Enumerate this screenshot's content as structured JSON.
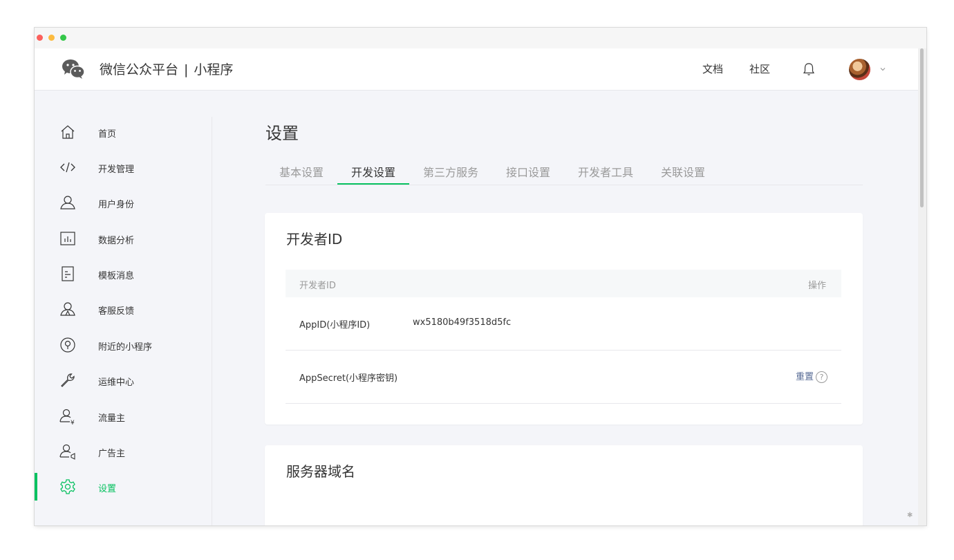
{
  "header": {
    "brand": "微信公众平台",
    "separator": "|",
    "product": "小程序",
    "nav": [
      {
        "label": "文档"
      },
      {
        "label": "社区"
      }
    ]
  },
  "sidebar": {
    "items": [
      {
        "label": "首页",
        "icon": "home-icon"
      },
      {
        "label": "开发管理",
        "icon": "code-icon"
      },
      {
        "label": "用户身份",
        "icon": "user-icon"
      },
      {
        "label": "数据分析",
        "icon": "chart-icon"
      },
      {
        "label": "模板消息",
        "icon": "document-icon"
      },
      {
        "label": "客服反馈",
        "icon": "customer-service-icon"
      },
      {
        "label": "附近的小程序",
        "icon": "location-icon"
      },
      {
        "label": "运维中心",
        "icon": "wrench-icon"
      },
      {
        "label": "流量主",
        "icon": "traffic-owner-icon"
      },
      {
        "label": "广告主",
        "icon": "advertiser-icon"
      },
      {
        "label": "设置",
        "icon": "gear-icon",
        "active": true
      }
    ]
  },
  "main": {
    "title": "设置",
    "tabs": [
      {
        "label": "基本设置"
      },
      {
        "label": "开发设置",
        "active": true
      },
      {
        "label": "第三方服务"
      },
      {
        "label": "接口设置"
      },
      {
        "label": "开发者工具"
      },
      {
        "label": "关联设置"
      }
    ],
    "developer_card": {
      "title": "开发者ID",
      "columns": [
        "开发者ID",
        "操作"
      ],
      "rows": [
        {
          "key": "AppID(小程序ID)",
          "value": "wx5180b49f3518d5fc",
          "action": ""
        },
        {
          "key": "AppSecret(小程序密钥)",
          "value": "",
          "action": "重置",
          "help": "?"
        }
      ]
    },
    "server_card": {
      "title": "服务器域名"
    }
  },
  "colors": {
    "accent": "#07c160",
    "link": "#576b95",
    "text": "#353535",
    "muted": "#9a9a9a"
  }
}
